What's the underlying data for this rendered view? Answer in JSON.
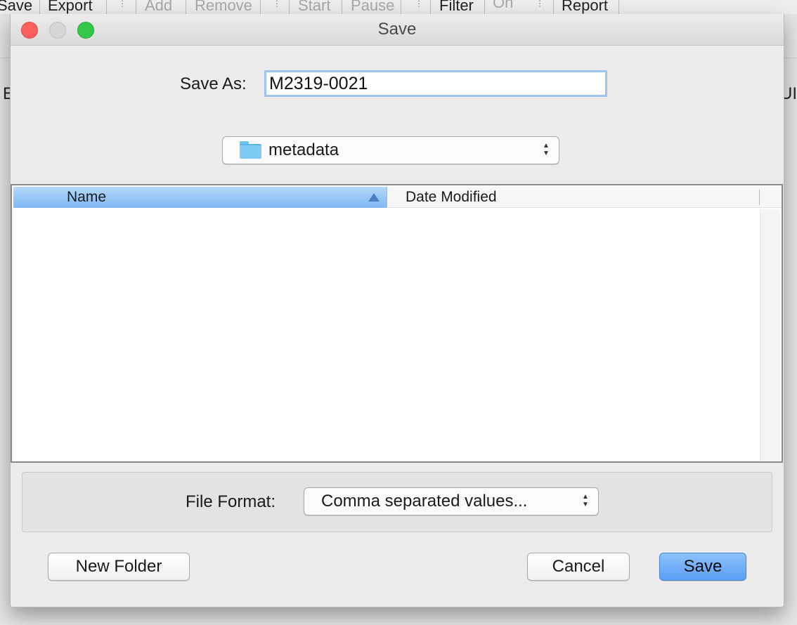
{
  "background_app": {
    "toolbar": {
      "items": [
        {
          "label": "Save",
          "enabled": true
        },
        {
          "label": "Export",
          "enabled": true
        },
        {
          "label": "Add",
          "enabled": false
        },
        {
          "label": "Remove",
          "enabled": false
        },
        {
          "label": "Start",
          "enabled": false
        },
        {
          "label": "Pause",
          "enabled": false
        },
        {
          "label": "Filter",
          "enabled": true
        },
        {
          "label": "On",
          "enabled": false
        },
        {
          "label": "Report",
          "enabled": true
        }
      ]
    },
    "left_edge_char": "E",
    "right_edge_char": "UI"
  },
  "dialog": {
    "title": "Save",
    "save_as_label": "Save As:",
    "save_as_value": "M2319-0021",
    "folder": {
      "name": "metadata",
      "icon": "folder-icon"
    },
    "file_list": {
      "columns": [
        {
          "label": "Name",
          "sorted": true,
          "sort_direction": "ascending"
        },
        {
          "label": "Date Modified"
        }
      ],
      "rows": []
    },
    "file_format": {
      "label": "File Format:",
      "value": "Comma separated values..."
    },
    "buttons": {
      "new_folder": "New Folder",
      "cancel": "Cancel",
      "save": "Save"
    }
  },
  "colors": {
    "accent": "#5a9ef5",
    "header_selected": "#7fb8f3",
    "close": "#fc605c",
    "minimize": "#d6d6d6",
    "maximize": "#34c84a",
    "folder_icon": "#7ecbf6"
  }
}
